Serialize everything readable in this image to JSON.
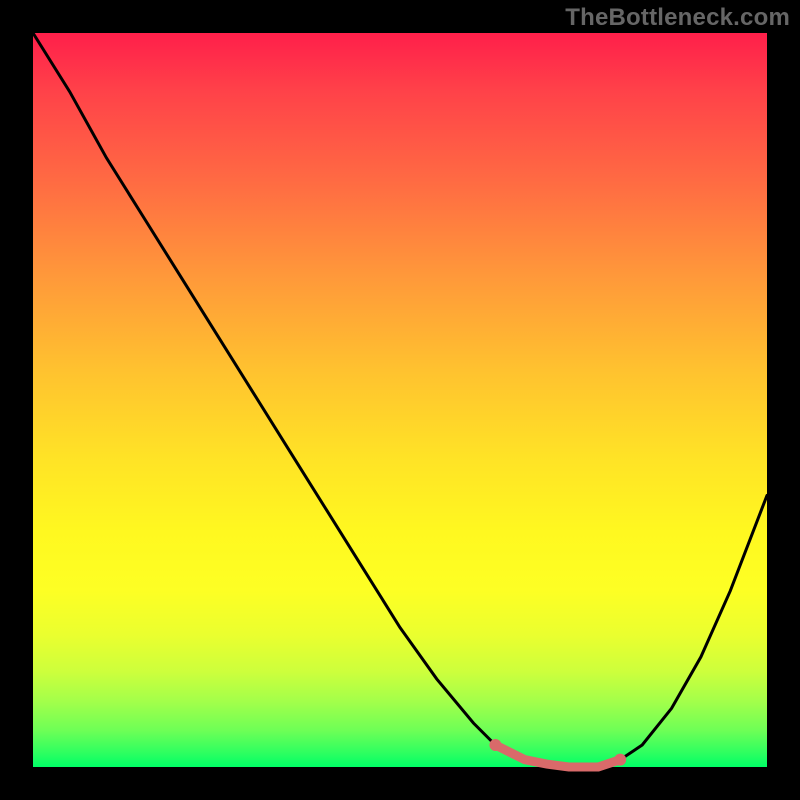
{
  "watermark": "TheBottleneck.com",
  "chart_data": {
    "type": "line",
    "title": "",
    "xlabel": "",
    "ylabel": "",
    "xlim": [
      0,
      100
    ],
    "ylim": [
      0,
      100
    ],
    "grid": false,
    "series": [
      {
        "name": "bottleneck-curve",
        "color": "#000000",
        "x": [
          0,
          5,
          10,
          15,
          20,
          25,
          30,
          35,
          40,
          45,
          50,
          55,
          60,
          63,
          67,
          73,
          77,
          80,
          83,
          87,
          91,
          95,
          100
        ],
        "y": [
          100,
          92,
          83,
          75,
          67,
          59,
          51,
          43,
          35,
          27,
          19,
          12,
          6,
          3,
          1,
          0,
          0,
          1,
          3,
          8,
          15,
          24,
          37
        ]
      }
    ],
    "highlight": {
      "name": "optimal-region",
      "color": "#e06666",
      "x": [
        63,
        67,
        70,
        73,
        77,
        80
      ],
      "y": [
        3,
        1,
        0.4,
        0,
        0,
        1
      ]
    }
  }
}
